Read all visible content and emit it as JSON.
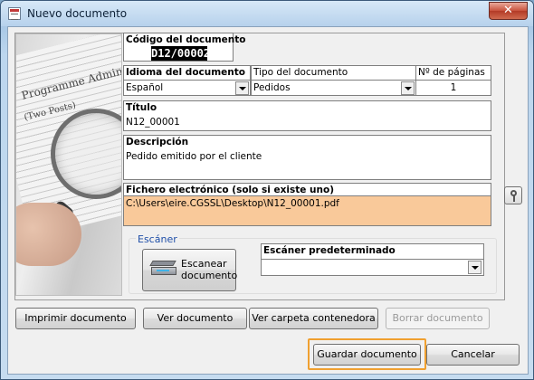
{
  "window": {
    "title": "Nuevo documento",
    "close_label": "✕"
  },
  "photo": {
    "text_line1": "Programme Adminis",
    "text_line2": "(Two Posts)"
  },
  "form": {
    "code": {
      "label": "Código del documento",
      "value": "D12/00002"
    },
    "language": {
      "label": "Idioma del documento",
      "value": "Español"
    },
    "doc_type": {
      "label": "Tipo del documento",
      "value": "Pedidos"
    },
    "pages": {
      "label": "Nº de páginas",
      "value": "1"
    },
    "title": {
      "label": "Título",
      "value": "N12_00001"
    },
    "description": {
      "label": "Descripción",
      "value": "Pedido emitido por el cliente"
    },
    "file": {
      "label": "Fichero electrónico (solo si existe uno)",
      "value": "C:\\Users\\eire.CGSSL\\Desktop\\N12_00001.pdf"
    }
  },
  "scanner": {
    "group_label": "Escáner",
    "scan_button": {
      "line1": "Escanear",
      "line2": "documento"
    },
    "default_scanner": {
      "label": "Escáner predeterminado",
      "value": ""
    }
  },
  "buttons": {
    "print": "Imprimir documento",
    "view": "Ver documento",
    "view_folder": "Ver carpeta contenedora",
    "delete": "Borrar documento",
    "save": "Guardar documento",
    "cancel": "Cancelar"
  },
  "colors": {
    "file_field_bg": "#f9c99a",
    "save_highlight": "#f0a030",
    "group_label": "#1f4fa8"
  }
}
